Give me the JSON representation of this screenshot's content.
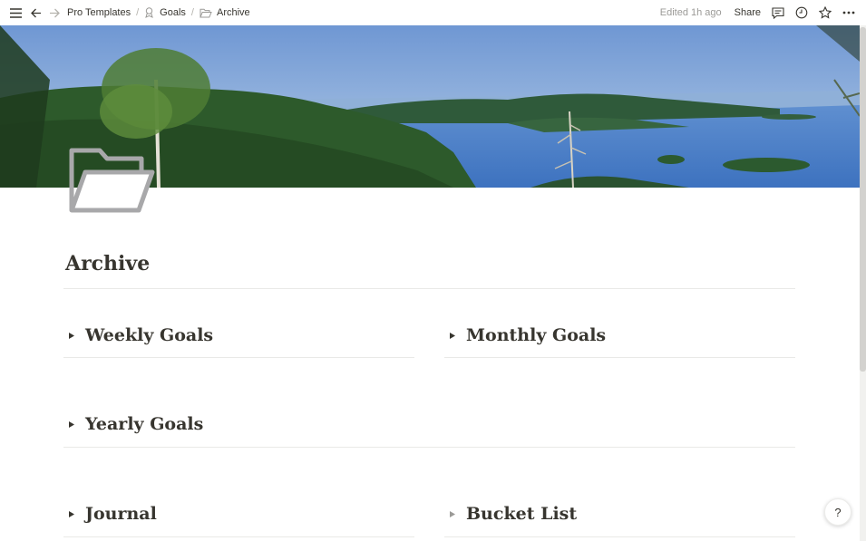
{
  "topbar": {
    "breadcrumbs": [
      {
        "label": "Pro Templates"
      },
      {
        "label": "Goals"
      },
      {
        "label": "Archive"
      }
    ],
    "separator": "/",
    "edited": "Edited 1h ago",
    "share": "Share"
  },
  "page": {
    "title": "Archive"
  },
  "toggles": [
    {
      "label": "Weekly Goals"
    },
    {
      "label": "Monthly Goals"
    },
    {
      "label": "Yearly Goals"
    },
    {
      "label": "Journal"
    },
    {
      "label": "Bucket List"
    }
  ],
  "help": {
    "label": "?"
  },
  "icons": [
    "menu-icon",
    "back-arrow-icon",
    "forward-arrow-icon",
    "goals-icon",
    "folder-open-icon",
    "comment-icon",
    "clock-icon",
    "star-icon",
    "more-icon",
    "toggle-triangle-icon"
  ],
  "colors": {
    "text": "#37352f",
    "muted": "#9b9a97",
    "divider": "#e9e9e7",
    "icon_gray": "#a9a9a9"
  }
}
